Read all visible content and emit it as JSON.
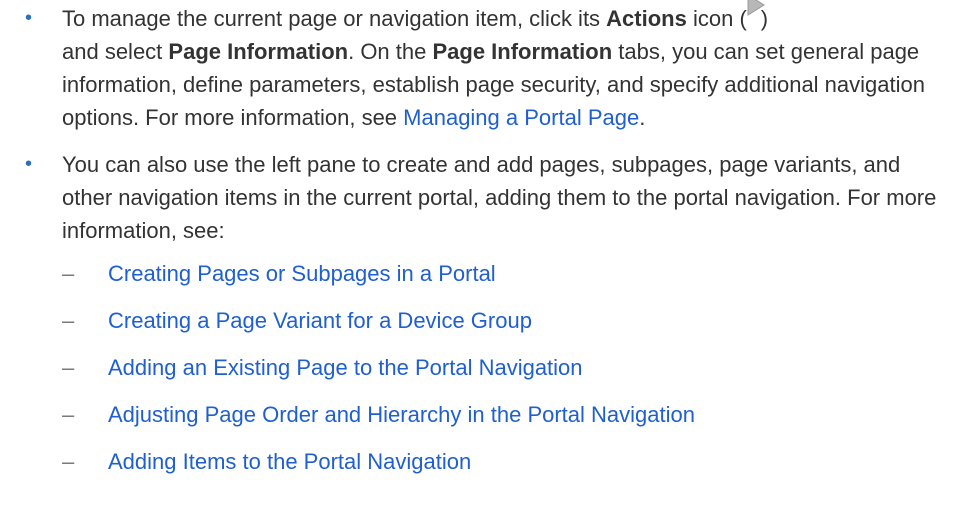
{
  "items": [
    {
      "bullet": "•",
      "text1": "To manage the current page or navigation item, click its ",
      "bold1": "Actions",
      "text2": " icon (",
      "icon": "actions-menu-icon",
      "text3": ")",
      "text4": "and select ",
      "bold2": "Page Information",
      "text5": ". On the ",
      "bold3": "Page Information",
      "text6": " tabs, you can set general page information, define parameters, establish page security, and specify additional navigation options. For more information, see ",
      "link": "Managing a Portal Page",
      "text7": "."
    },
    {
      "bullet": "•",
      "text": "You can also use the left pane to create and add pages, subpages, page variants, and other navigation items in the current portal, adding them to the portal navigation. For more information, see:",
      "subitems": [
        {
          "dash": "–",
          "label": "Creating Pages or Subpages in a Portal"
        },
        {
          "dash": "–",
          "label": "Creating a Page Variant for a Device Group"
        },
        {
          "dash": "–",
          "label": "Adding an Existing Page to the Portal Navigation"
        },
        {
          "dash": "–",
          "label": "Adjusting Page Order and Hierarchy in the Portal Navigation"
        },
        {
          "dash": "–",
          "label": "Adding Items to the Portal Navigation"
        }
      ]
    }
  ],
  "colors": {
    "text": "#333333",
    "link": "#1f5fcf",
    "bullet": "#2e6fba",
    "icon": "#b8b8b8"
  }
}
